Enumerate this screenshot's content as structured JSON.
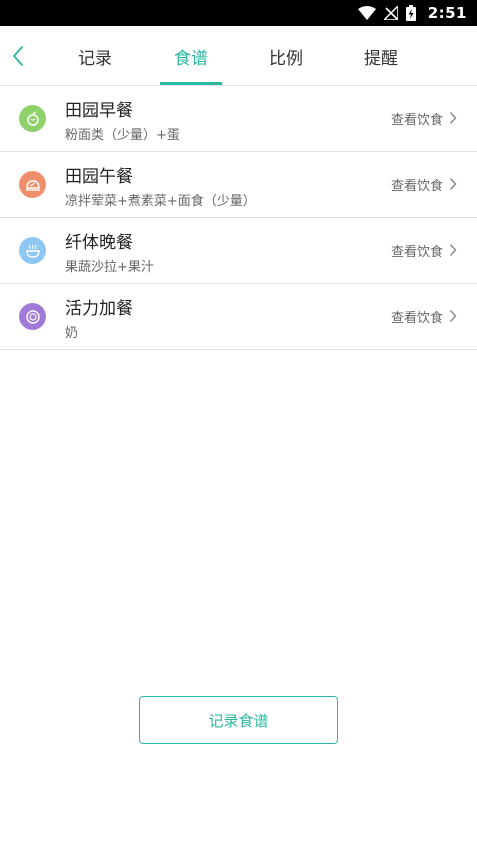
{
  "status_bar": {
    "time": "2:51",
    "icons": [
      "wifi-icon",
      "no-signal-icon",
      "battery-charging-icon"
    ]
  },
  "nav": {
    "back_icon": "chevron-left-icon",
    "tabs": [
      {
        "label": "记录",
        "active": false
      },
      {
        "label": "食谱",
        "active": true
      },
      {
        "label": "比例",
        "active": false
      },
      {
        "label": "提醒",
        "active": false
      }
    ]
  },
  "colors": {
    "accent": "#2bb8a3",
    "breakfast": "#8fd16a",
    "lunch": "#f08f6b",
    "dinner": "#8ec8f2",
    "snack": "#a07ad6"
  },
  "meals": [
    {
      "title": "田园早餐",
      "subtitle": "粉面类（少量）+蛋",
      "link": "查看饮食",
      "icon": "apple-icon"
    },
    {
      "title": "田园午餐",
      "subtitle": "凉拌荤菜+煮素菜+面食（少量）",
      "link": "查看饮食",
      "icon": "plate-icon"
    },
    {
      "title": "纤体晚餐",
      "subtitle": "果蔬沙拉+果汁",
      "link": "查看饮食",
      "icon": "bowl-icon"
    },
    {
      "title": "活力加餐",
      "subtitle": "奶",
      "link": "查看饮食",
      "icon": "dish-icon"
    }
  ],
  "footer": {
    "record_button": "记录食谱"
  }
}
